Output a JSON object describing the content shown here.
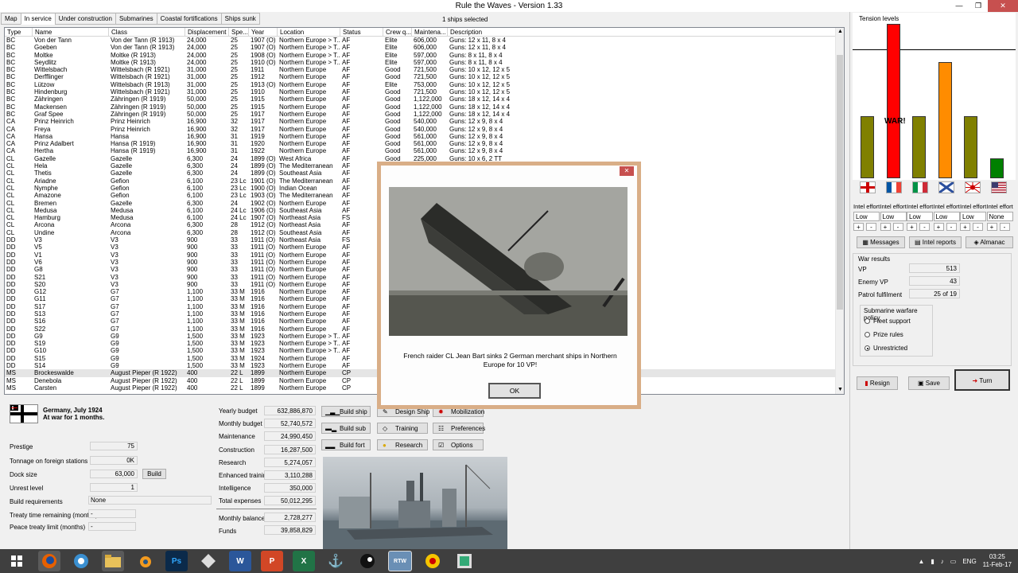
{
  "window": {
    "title": "Rule the Waves - Version 1.33",
    "minimize": "—",
    "maximize": "❐",
    "close": "✕"
  },
  "tabs": [
    "Map",
    "In service",
    "Under construction",
    "Submarines",
    "Coastal fortifications",
    "Ships sunk"
  ],
  "selected_count": "1 ships selected",
  "table": {
    "columns": [
      "Type",
      "Name",
      "Class",
      "Displacement",
      "Spe...",
      "Year",
      "Location",
      "Status",
      "Crew q...",
      "Maintena...",
      "Description"
    ],
    "rows": [
      [
        "BC",
        "Von der Tann",
        "Von der Tann (R 1913)",
        "24,000",
        "25",
        "1907 (O)",
        "Northern Europe > T...",
        "AF",
        "Elite",
        "606,000",
        "Guns: 12 x 11, 8 x 4"
      ],
      [
        "BC",
        "Goeben",
        "Von der Tann (R 1913)",
        "24,000",
        "25",
        "1907 (O)",
        "Northern Europe > T...",
        "AF",
        "Elite",
        "606,000",
        "Guns: 12 x 11, 8 x 4"
      ],
      [
        "BC",
        "Moltke",
        "Moltke (R 1913)",
        "24,000",
        "25",
        "1908 (O)",
        "Northern Europe > T...",
        "AF",
        "Elite",
        "597,000",
        "Guns: 8 x 11, 8 x 4"
      ],
      [
        "BC",
        "Seydlitz",
        "Moltke (R 1913)",
        "24,000",
        "25",
        "1910 (O)",
        "Northern Europe > T...",
        "AF",
        "Elite",
        "597,000",
        "Guns: 8 x 11, 8 x 4"
      ],
      [
        "BC",
        "Wittelsbach",
        "Wittelsbach (R 1921)",
        "31,000",
        "25",
        "1911",
        "Northern Europe",
        "AF",
        "Good",
        "721,500",
        "Guns: 10 x 12, 12 x 5"
      ],
      [
        "BC",
        "Derfflinger",
        "Wittelsbach (R 1921)",
        "31,000",
        "25",
        "1912",
        "Northern Europe",
        "AF",
        "Good",
        "721,500",
        "Guns: 10 x 12, 12 x 5"
      ],
      [
        "BC",
        "Lützow",
        "Wittelsbach (R 1913)",
        "31,000",
        "25",
        "1913 (O)",
        "Northern Europe",
        "AF",
        "Elite",
        "753,000",
        "Guns: 10 x 12, 12 x 5"
      ],
      [
        "BC",
        "Hindenburg",
        "Wittelsbach (R 1921)",
        "31,000",
        "25",
        "1910",
        "Northern Europe",
        "AF",
        "Good",
        "721,500",
        "Guns: 10 x 12, 12 x 5"
      ],
      [
        "BC",
        "Zähringen",
        "Zähringen (R 1919)",
        "50,000",
        "25",
        "1915",
        "Northern Europe",
        "AF",
        "Good",
        "1,122,000",
        "Guns: 18 x 12, 14 x 4"
      ],
      [
        "BC",
        "Mackensen",
        "Zähringen (R 1919)",
        "50,000",
        "25",
        "1915",
        "Northern Europe",
        "AF",
        "Good",
        "1,122,000",
        "Guns: 18 x 12, 14 x 4"
      ],
      [
        "BC",
        "Graf Spee",
        "Zähringen (R 1919)",
        "50,000",
        "25",
        "1917",
        "Northern Europe",
        "AF",
        "Good",
        "1,122,000",
        "Guns: 18 x 12, 14 x 4"
      ],
      [
        "CA",
        "Prinz Heinrich",
        "Prinz Heinrich",
        "16,900",
        "32",
        "1917",
        "Northern Europe",
        "AF",
        "Good",
        "540,000",
        "Guns: 12 x 9, 8 x 4"
      ],
      [
        "CA",
        "Freya",
        "Prinz Heinrich",
        "16,900",
        "32",
        "1917",
        "Northern Europe",
        "AF",
        "Good",
        "540,000",
        "Guns: 12 x 9, 8 x 4"
      ],
      [
        "CA",
        "Hansa",
        "Hansa",
        "16,900",
        "31",
        "1919",
        "Northern Europe",
        "AF",
        "Good",
        "561,000",
        "Guns: 12 x 9, 8 x 4"
      ],
      [
        "CA",
        "Prinz Adalbert",
        "Hansa (R 1919)",
        "16,900",
        "31",
        "1920",
        "Northern Europe",
        "AF",
        "Good",
        "561,000",
        "Guns: 12 x 9, 8 x 4"
      ],
      [
        "CA",
        "Hertha",
        "Hansa (R 1919)",
        "16,900",
        "31",
        "1922",
        "Northern Europe",
        "AF",
        "Good",
        "561,000",
        "Guns: 12 x 9, 8 x 4"
      ],
      [
        "CL",
        "Gazelle",
        "Gazelle",
        "6,300",
        "24",
        "1899 (O)",
        "West Africa",
        "AF",
        "Good",
        "225,000",
        "Guns: 10 x 6, 2 TT"
      ],
      [
        "CL",
        "Hela",
        "Gazelle",
        "6,300",
        "24",
        "1899 (O)",
        "The Mediterranean",
        "AF",
        "",
        "",
        ""
      ],
      [
        "CL",
        "Thetis",
        "Gazelle",
        "6,300",
        "24",
        "1899 (O)",
        "Southeast Asia",
        "AF",
        "",
        "",
        ""
      ],
      [
        "CL",
        "Ariadne",
        "Gefion",
        "6,100",
        "23 Lc",
        "1901 (O)",
        "The Mediterranean",
        "AF",
        "",
        "",
        ""
      ],
      [
        "CL",
        "Nymphe",
        "Gefion",
        "6,100",
        "23 Lc",
        "1900 (O)",
        "Indian Ocean",
        "AF",
        "",
        "",
        ""
      ],
      [
        "CL",
        "Amazone",
        "Gefion",
        "6,100",
        "23 Lc",
        "1903 (O)",
        "The Mediterranean",
        "AF",
        "",
        "",
        ""
      ],
      [
        "CL",
        "Bremen",
        "Gazelle",
        "6,300",
        "24",
        "1902 (O)",
        "Northern Europe",
        "AF",
        "",
        "",
        ""
      ],
      [
        "CL",
        "Medusa",
        "Medusa",
        "6,100",
        "24 Lc",
        "1906 (O)",
        "Southeast Asia",
        "AF",
        "",
        "",
        ""
      ],
      [
        "CL",
        "Hamburg",
        "Medusa",
        "6,100",
        "24 Lc",
        "1907 (O)",
        "Northeast Asia",
        "FS",
        "",
        "",
        ""
      ],
      [
        "CL",
        "Arcona",
        "Arcona",
        "6,300",
        "28",
        "1912 (O)",
        "Northeast Asia",
        "AF",
        "",
        "",
        ""
      ],
      [
        "CL",
        "Undine",
        "Arcona",
        "6,300",
        "28",
        "1912 (O)",
        "Southeast Asia",
        "AF",
        "",
        "",
        ""
      ],
      [
        "DD",
        "V3",
        "V3",
        "900",
        "33",
        "1911 (O)",
        "Northeast Asia",
        "FS",
        "",
        "",
        ""
      ],
      [
        "DD",
        "V5",
        "V3",
        "900",
        "33",
        "1911 (O)",
        "Northern Europe",
        "AF",
        "",
        "",
        ""
      ],
      [
        "DD",
        "V1",
        "V3",
        "900",
        "33",
        "1911 (O)",
        "Northern Europe",
        "AF",
        "",
        "",
        ""
      ],
      [
        "DD",
        "V6",
        "V3",
        "900",
        "33",
        "1911 (O)",
        "Northern Europe",
        "AF",
        "",
        "",
        ""
      ],
      [
        "DD",
        "G8",
        "V3",
        "900",
        "33",
        "1911 (O)",
        "Northern Europe",
        "AF",
        "",
        "",
        ""
      ],
      [
        "DD",
        "S21",
        "V3",
        "900",
        "33",
        "1911 (O)",
        "Northern Europe",
        "AF",
        "",
        "",
        ""
      ],
      [
        "DD",
        "S20",
        "V3",
        "900",
        "33",
        "1911 (O)",
        "Northern Europe",
        "AF",
        "",
        "",
        ""
      ],
      [
        "DD",
        "G12",
        "G7",
        "1,100",
        "33 M",
        "1916",
        "Northern Europe",
        "AF",
        "",
        "",
        ""
      ],
      [
        "DD",
        "G11",
        "G7",
        "1,100",
        "33 M",
        "1916",
        "Northern Europe",
        "AF",
        "",
        "",
        ""
      ],
      [
        "DD",
        "S17",
        "G7",
        "1,100",
        "33 M",
        "1916",
        "Northern Europe",
        "AF",
        "",
        "",
        ""
      ],
      [
        "DD",
        "S13",
        "G7",
        "1,100",
        "33 M",
        "1916",
        "Northern Europe",
        "AF",
        "",
        "",
        ""
      ],
      [
        "DD",
        "S16",
        "G7",
        "1,100",
        "33 M",
        "1916",
        "Northern Europe",
        "AF",
        "",
        "",
        ""
      ],
      [
        "DD",
        "S22",
        "G7",
        "1,100",
        "33 M",
        "1916",
        "Northern Europe",
        "AF",
        "",
        "",
        ""
      ],
      [
        "DD",
        "G9",
        "G9",
        "1,500",
        "33 M",
        "1923",
        "Northern Europe > T...",
        "AF",
        "",
        "",
        ""
      ],
      [
        "DD",
        "S19",
        "G9",
        "1,500",
        "33 M",
        "1923",
        "Northern Europe > T...",
        "AF",
        "",
        "",
        ""
      ],
      [
        "DD",
        "G10",
        "G9",
        "1,500",
        "33 M",
        "1923",
        "Northern Europe > T...",
        "AF",
        "",
        "",
        ""
      ],
      [
        "DD",
        "S15",
        "G9",
        "1,500",
        "33 M",
        "1924",
        "Northern Europe",
        "AF",
        "",
        "",
        ""
      ],
      [
        "DD",
        "S14",
        "G9",
        "1,500",
        "33 M",
        "1923",
        "Northern Europe",
        "AF",
        "",
        "",
        ""
      ],
      [
        "MS",
        "Brockeswalde",
        "August Pieper (R 1922)",
        "400",
        "22 L",
        "1899",
        "Northern Europe",
        "CP",
        "",
        "",
        ""
      ],
      [
        "MS",
        "Denebola",
        "August Pieper (R 1922)",
        "400",
        "22 L",
        "1899",
        "Northern Europe",
        "CP",
        "",
        "",
        ""
      ],
      [
        "MS",
        "Carsten",
        "August Pieper (R 1922)",
        "400",
        "22 L",
        "1899",
        "Northern Europe",
        "CP",
        "",
        "",
        ""
      ]
    ]
  },
  "tension": {
    "title": "Tension levels",
    "war_label": "WAR!",
    "bars": [
      {
        "nation": "Britain",
        "level": 0.4,
        "color": "#808000"
      },
      {
        "nation": "France",
        "level": 1.0,
        "color": "#ff0000"
      },
      {
        "nation": "Italy",
        "level": 0.4,
        "color": "#808000"
      },
      {
        "nation": "Russia",
        "level": 0.75,
        "color": "#ff8c00"
      },
      {
        "nation": "Japan",
        "level": 0.4,
        "color": "#808000"
      },
      {
        "nation": "USA",
        "level": 0.13,
        "color": "#008000"
      }
    ]
  },
  "intel": {
    "label": "Intel effort",
    "values": [
      "Low",
      "Low",
      "Low",
      "Low",
      "Low",
      "None"
    ],
    "plus": "+",
    "minus": "-"
  },
  "right_buttons": {
    "messages": "Messages",
    "intel_reports": "Intel reports",
    "almanac": "Almanac",
    "resign": "Resign",
    "save": "Save",
    "turn": "Turn"
  },
  "war_results": {
    "title": "War results",
    "vp_label": "VP",
    "vp": "513",
    "enemy_vp_label": "Enemy VP",
    "enemy_vp": "43",
    "patrol_label": "Patrol fulfilment",
    "patrol": "25 of 19",
    "policy_title": "Submarine warfare policy",
    "policies": [
      "Fleet support",
      "Prize rules",
      "Unrestricted"
    ],
    "selected_policy": 2
  },
  "nation": {
    "line1": "Germany, July 1924",
    "line2": "At war for 1 months."
  },
  "stats": {
    "prestige_label": "Prestige",
    "prestige": "75",
    "tonnage_label": "Tonnage on foreign stations",
    "tonnage": "0K",
    "dock_label": "Dock size",
    "dock": "63,000",
    "build": "Build",
    "unrest_label": "Unrest level",
    "unrest": "1",
    "req_label": "Build requirements",
    "req": "None",
    "treaty_label": "Treaty time remaining (months)",
    "treaty": "-",
    "peace_label": "Peace treaty limit (months)",
    "peace": "-"
  },
  "budget": {
    "yearly_label": "Yearly budget",
    "yearly": "632,886,870",
    "monthly_label": "Monthly budget",
    "monthly": "52,740,572",
    "maint_label": "Maintenance",
    "maint": "24,990,450",
    "constr_label": "Construction",
    "constr": "16,287,500",
    "research_label": "Research",
    "research": "5,274,057",
    "training_label": "Enhanced training",
    "training": "3,110,288",
    "intel_label": "Intelligence",
    "intel": "350,000",
    "total_label": "Total expenses",
    "total": "50,012,295",
    "balance_label": "Monthly balance",
    "balance": "2,728,277",
    "funds_label": "Funds",
    "funds": "39,858,829"
  },
  "actions": {
    "build_ship": "Build ship",
    "design_ship": "Design Ship",
    "mobilization": "Mobilization",
    "build_sub": "Build sub",
    "training": "Training",
    "preferences": "Preferences",
    "build_fort": "Build fort",
    "research": "Research",
    "options": "Options"
  },
  "dialog": {
    "message": "French raider CL Jean Bart sinks 2 German merchant ships in Northern Europe for 10 VP!",
    "ok": "OK",
    "close": "✕"
  },
  "taskbar": {
    "icons": [
      "windows-start",
      "firefox",
      "app",
      "file-explorer",
      "blender",
      "photoshop",
      "app",
      "word",
      "powerpoint",
      "excel",
      "steam",
      "app",
      "rule-the-waves",
      "app",
      "app"
    ],
    "ps": "Ps",
    "w": "W",
    "p": "P",
    "x": "X",
    "rtw": "RTW",
    "lang": "ENG",
    "time": "03:25",
    "date": "11-Feb-17"
  }
}
